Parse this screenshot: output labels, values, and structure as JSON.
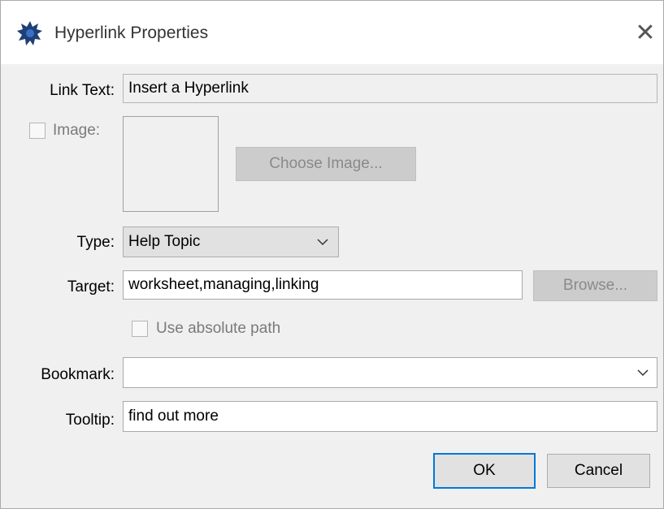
{
  "window": {
    "title": "Hyperlink Properties",
    "close_glyph": "✕",
    "icon": "app-splash-icon"
  },
  "link_text": {
    "label": "Link Text:",
    "value": "Insert a Hyperlink"
  },
  "image": {
    "checkbox_label": "Image:",
    "checked": false,
    "choose_button": "Choose Image..."
  },
  "type": {
    "label": "Type:",
    "value": "Help Topic"
  },
  "target": {
    "label": "Target:",
    "value": "worksheet,managing,linking",
    "browse_button": "Browse..."
  },
  "absolute_path": {
    "label": "Use absolute path",
    "checked": false
  },
  "bookmark": {
    "label": "Bookmark:",
    "value": ""
  },
  "tooltip": {
    "label": "Tooltip:",
    "value": "find out more"
  },
  "buttons": {
    "ok": "OK",
    "cancel": "Cancel"
  },
  "colors": {
    "accent": "#0078d7",
    "dialog_bg": "#f0f0f0",
    "titlebar_bg": "#ffffff"
  }
}
